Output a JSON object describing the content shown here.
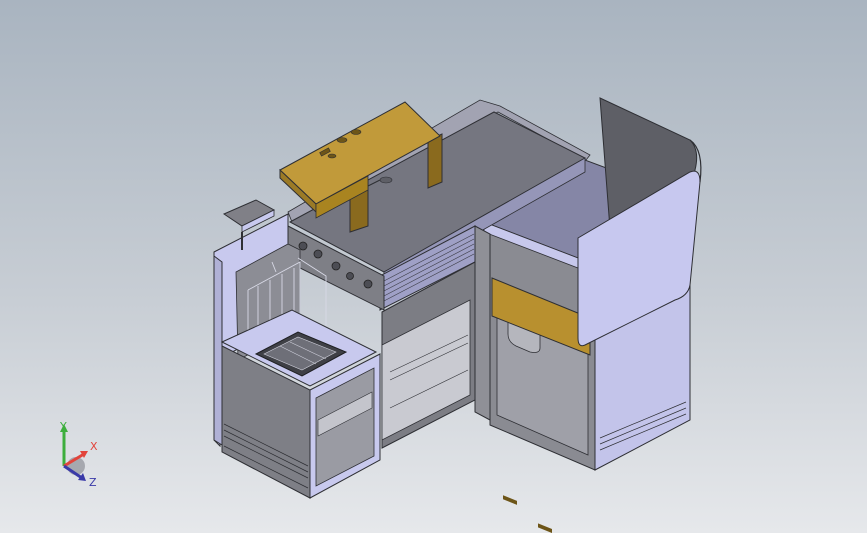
{
  "triad": {
    "x_label": "X",
    "y_label": "Y",
    "z_label": "Z",
    "x_color": "#e2443b",
    "y_color": "#3dae3d",
    "z_color": "#3a3aa8"
  },
  "colors": {
    "background_top": "#a9b4c0",
    "background_bottom": "#e6e8eb",
    "wood": "#b8902f",
    "panel_lavender": "#c8c9ee",
    "panel_grey": "#7e7f86",
    "shadow": "#3f4046"
  }
}
